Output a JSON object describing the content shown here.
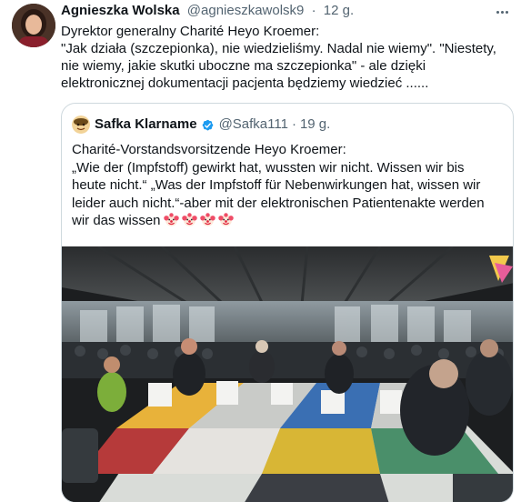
{
  "tweet": {
    "author_name": "Agnieszka Wolska",
    "author_handle": "@agnieszkawolsk9",
    "separator": "·",
    "time": "12 g.",
    "text_lines": [
      "Dyrektor generalny Charité Heyo Kroemer:",
      "\"Jak działa (szczepionka), nie wiedzieliśmy. Nadal nie wiemy\". \"Niestety,",
      "nie wiemy, jakie skutki uboczne ma szczepionka\" - ale dzięki",
      "elektronicznej dokumentacji pacjenta będziemy wiedzieć ......"
    ],
    "more_icon": "more-horizontal-icon"
  },
  "quoted": {
    "author_name": "Safka Klarname",
    "author_handle": "@Safka111",
    "separator": "·",
    "time": "19 g.",
    "verified_icon": "verified-badge-icon",
    "verified_color": "#1d9bf0",
    "text_lines": [
      "Charité-Vorstandsvorsitzende Heyo Kroemer:",
      "„Wie der (Impfstoff) gewirkt hat, wussten wir nicht. Wissen wir bis",
      "heute nicht.“ „Was der Impfstoff für Nebenwirkungen hat, wissen wir",
      "leider auch nicht.“-aber mit der elektronischen Patientenakte werden",
      "wir das wissen"
    ],
    "emoji": [
      "clown-face-icon",
      "clown-face-icon",
      "clown-face-icon",
      "clown-face-icon"
    ],
    "media": "video-still-talk-show-studio"
  },
  "colors": {
    "text": "#0f1419",
    "secondary": "#536471",
    "border": "#cfd9de"
  }
}
